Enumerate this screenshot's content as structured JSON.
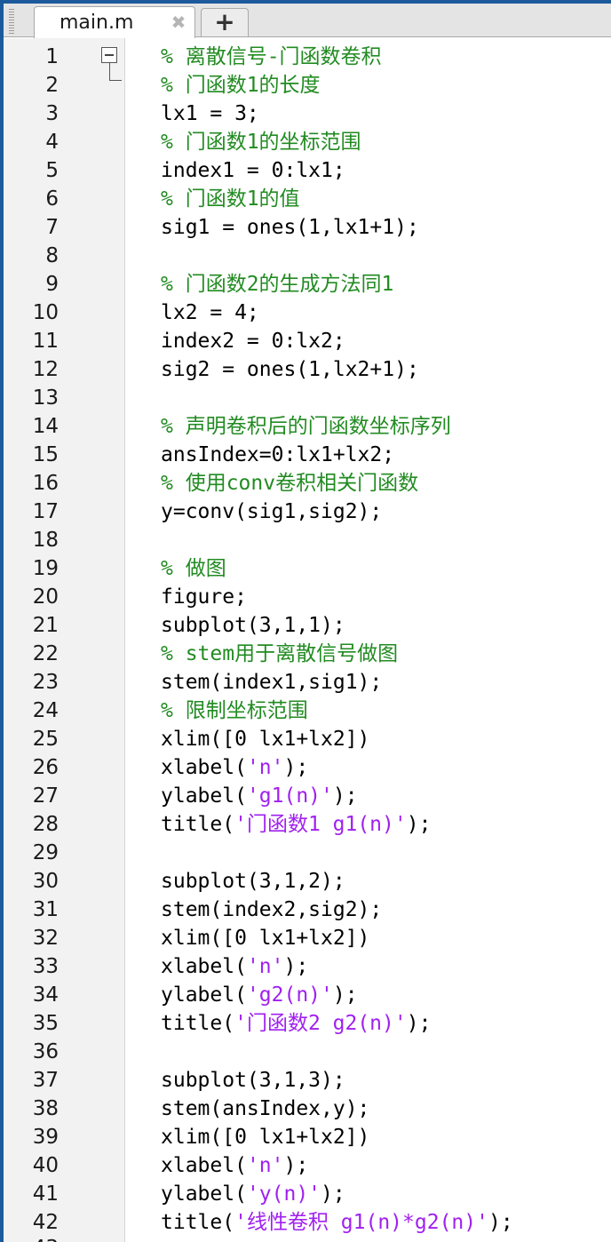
{
  "tab": {
    "filename": "main.m",
    "close_icon": "close-icon",
    "add_label": "+"
  },
  "colors": {
    "comment": "#228b22",
    "string": "#a020f0",
    "text": "#000000",
    "gutter": "#f2f2f2"
  },
  "editor": {
    "lines": [
      {
        "n": "1",
        "tokens": [
          {
            "t": "c",
            "v": "% 离散信号-门函数卷积"
          }
        ]
      },
      {
        "n": "2",
        "tokens": [
          {
            "t": "c",
            "v": "% 门函数1的长度"
          }
        ]
      },
      {
        "n": "3",
        "tokens": [
          {
            "t": "p",
            "v": "lx1 = 3;"
          }
        ]
      },
      {
        "n": "4",
        "tokens": [
          {
            "t": "c",
            "v": "% 门函数1的坐标范围"
          }
        ]
      },
      {
        "n": "5",
        "tokens": [
          {
            "t": "p",
            "v": "index1 = 0:lx1;"
          }
        ]
      },
      {
        "n": "6",
        "tokens": [
          {
            "t": "c",
            "v": "% 门函数1的值"
          }
        ]
      },
      {
        "n": "7",
        "tokens": [
          {
            "t": "p",
            "v": "sig1 = ones(1,lx1+1);"
          }
        ]
      },
      {
        "n": "8",
        "tokens": []
      },
      {
        "n": "9",
        "tokens": [
          {
            "t": "c",
            "v": "% 门函数2的生成方法同1"
          }
        ]
      },
      {
        "n": "10",
        "tokens": [
          {
            "t": "p",
            "v": "lx2 = 4;"
          }
        ]
      },
      {
        "n": "11",
        "tokens": [
          {
            "t": "p",
            "v": "index2 = 0:lx2;"
          }
        ]
      },
      {
        "n": "12",
        "tokens": [
          {
            "t": "p",
            "v": "sig2 = ones(1,lx2+1);"
          }
        ]
      },
      {
        "n": "13",
        "tokens": []
      },
      {
        "n": "14",
        "tokens": [
          {
            "t": "c",
            "v": "% 声明卷积后的门函数坐标序列"
          }
        ]
      },
      {
        "n": "15",
        "tokens": [
          {
            "t": "p",
            "v": "ansIndex=0:lx1+lx2;"
          }
        ]
      },
      {
        "n": "16",
        "tokens": [
          {
            "t": "c",
            "v": "% 使用conv卷积相关门函数"
          }
        ]
      },
      {
        "n": "17",
        "tokens": [
          {
            "t": "p",
            "v": "y=conv(sig1,sig2);"
          }
        ]
      },
      {
        "n": "18",
        "tokens": []
      },
      {
        "n": "19",
        "tokens": [
          {
            "t": "c",
            "v": "% 做图"
          }
        ]
      },
      {
        "n": "20",
        "tokens": [
          {
            "t": "p",
            "v": "figure;"
          }
        ]
      },
      {
        "n": "21",
        "tokens": [
          {
            "t": "p",
            "v": "subplot(3,1,1);"
          }
        ]
      },
      {
        "n": "22",
        "tokens": [
          {
            "t": "c",
            "v": "% stem用于离散信号做图"
          }
        ]
      },
      {
        "n": "23",
        "tokens": [
          {
            "t": "p",
            "v": "stem(index1,sig1);"
          }
        ]
      },
      {
        "n": "24",
        "tokens": [
          {
            "t": "c",
            "v": "% 限制坐标范围"
          }
        ]
      },
      {
        "n": "25",
        "tokens": [
          {
            "t": "p",
            "v": "xlim([0 lx1+lx2])"
          }
        ]
      },
      {
        "n": "26",
        "tokens": [
          {
            "t": "p",
            "v": "xlabel("
          },
          {
            "t": "s",
            "v": "'n'"
          },
          {
            "t": "p",
            "v": ");"
          }
        ]
      },
      {
        "n": "27",
        "tokens": [
          {
            "t": "p",
            "v": "ylabel("
          },
          {
            "t": "s",
            "v": "'g1(n)'"
          },
          {
            "t": "p",
            "v": ");"
          }
        ]
      },
      {
        "n": "28",
        "tokens": [
          {
            "t": "p",
            "v": "title("
          },
          {
            "t": "s",
            "v": "'门函数1 g1(n)'"
          },
          {
            "t": "p",
            "v": ");"
          }
        ]
      },
      {
        "n": "29",
        "tokens": []
      },
      {
        "n": "30",
        "tokens": [
          {
            "t": "p",
            "v": "subplot(3,1,2);"
          }
        ]
      },
      {
        "n": "31",
        "tokens": [
          {
            "t": "p",
            "v": "stem(index2,sig2);"
          }
        ]
      },
      {
        "n": "32",
        "tokens": [
          {
            "t": "p",
            "v": "xlim([0 lx1+lx2])"
          }
        ]
      },
      {
        "n": "33",
        "tokens": [
          {
            "t": "p",
            "v": "xlabel("
          },
          {
            "t": "s",
            "v": "'n'"
          },
          {
            "t": "p",
            "v": ");"
          }
        ]
      },
      {
        "n": "34",
        "tokens": [
          {
            "t": "p",
            "v": "ylabel("
          },
          {
            "t": "s",
            "v": "'g2(n)'"
          },
          {
            "t": "p",
            "v": ");"
          }
        ]
      },
      {
        "n": "35",
        "tokens": [
          {
            "t": "p",
            "v": "title("
          },
          {
            "t": "s",
            "v": "'门函数2 g2(n)'"
          },
          {
            "t": "p",
            "v": ");"
          }
        ]
      },
      {
        "n": "36",
        "tokens": []
      },
      {
        "n": "37",
        "tokens": [
          {
            "t": "p",
            "v": "subplot(3,1,3);"
          }
        ]
      },
      {
        "n": "38",
        "tokens": [
          {
            "t": "p",
            "v": "stem(ansIndex,y);"
          }
        ]
      },
      {
        "n": "39",
        "tokens": [
          {
            "t": "p",
            "v": "xlim([0 lx1+lx2])"
          }
        ]
      },
      {
        "n": "40",
        "tokens": [
          {
            "t": "p",
            "v": "xlabel("
          },
          {
            "t": "s",
            "v": "'n'"
          },
          {
            "t": "p",
            "v": ");"
          }
        ]
      },
      {
        "n": "41",
        "tokens": [
          {
            "t": "p",
            "v": "ylabel("
          },
          {
            "t": "s",
            "v": "'y(n)'"
          },
          {
            "t": "p",
            "v": ");"
          }
        ]
      },
      {
        "n": "42",
        "tokens": [
          {
            "t": "p",
            "v": "title("
          },
          {
            "t": "s",
            "v": "'线性卷积 g1(n)*g2(n)'"
          },
          {
            "t": "p",
            "v": ");"
          }
        ]
      }
    ],
    "next_line_number": "43"
  }
}
